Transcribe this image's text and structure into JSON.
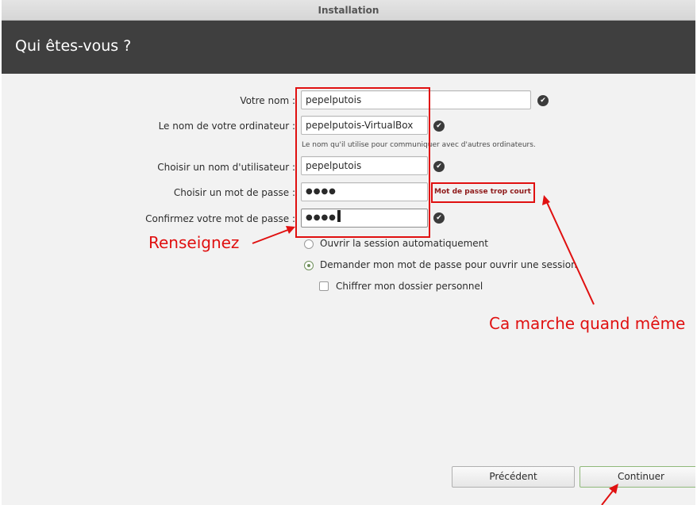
{
  "window": {
    "title": "Installation"
  },
  "header": {
    "title": "Qui êtes-vous ?"
  },
  "form": {
    "name": {
      "label": "Votre nom :",
      "value": "pepelputois"
    },
    "computer": {
      "label": "Le nom de votre ordinateur :",
      "value": "pepelputois-VirtualBox",
      "hint": "Le nom qu'il utilise pour communiquer avec d'autres ordinateurs."
    },
    "username": {
      "label": "Choisir un nom d'utilisateur :",
      "value": "pepelputois"
    },
    "password": {
      "label": "Choisir un mot de passe :",
      "value": "●●●●",
      "error": "Mot de passe trop court"
    },
    "confirm": {
      "label": "Confirmez votre mot de passe :",
      "value": "●●●●"
    },
    "login_options": {
      "auto_login": {
        "label": "Ouvrir la session automatiquement",
        "selected": false
      },
      "require_password": {
        "label": "Demander mon mot de passe pour ouvrir une session",
        "selected": true
      },
      "encrypt_home": {
        "label": "Chiffrer mon dossier personnel",
        "checked": false
      }
    }
  },
  "buttons": {
    "back": "Précédent",
    "continue": "Continuer"
  },
  "annotations": {
    "left": "Renseignez",
    "right": "Ca marche quand même"
  },
  "icons": {
    "valid": "check-circle-icon"
  },
  "colors": {
    "annotation": "#e01010",
    "header_bg": "#3f3f3f",
    "error_text": "#8f1a1a",
    "accent": "#6e8f5a"
  }
}
